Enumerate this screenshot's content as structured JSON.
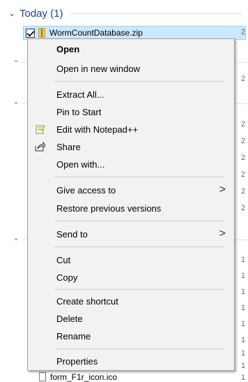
{
  "group": {
    "title": "Today (1)",
    "chevron": "chevron-down-icon"
  },
  "selected_file": {
    "name": "WormCountDatabase.zip",
    "date_fragment": "2",
    "icon": "zip-folder-icon"
  },
  "background": {
    "date_fragments": [
      "2",
      "2",
      "2",
      "2",
      "2",
      "2",
      "2",
      "1",
      "1",
      "1",
      "1",
      "1",
      "1",
      "1",
      "1",
      "1"
    ],
    "bottom_file": "form_F1r_icon.ico"
  },
  "menu": {
    "open": "Open",
    "open_new_window": "Open in new window",
    "extract_all": "Extract All...",
    "pin_to_start": "Pin to Start",
    "edit_notepad": "Edit with Notepad++",
    "share": "Share",
    "open_with": "Open with...",
    "give_access": "Give access to",
    "restore_versions": "Restore previous versions",
    "send_to": "Send to",
    "cut": "Cut",
    "copy": "Copy",
    "create_shortcut": "Create shortcut",
    "delete": "Delete",
    "rename": "Rename",
    "properties": "Properties",
    "submenu_arrow": ">"
  }
}
